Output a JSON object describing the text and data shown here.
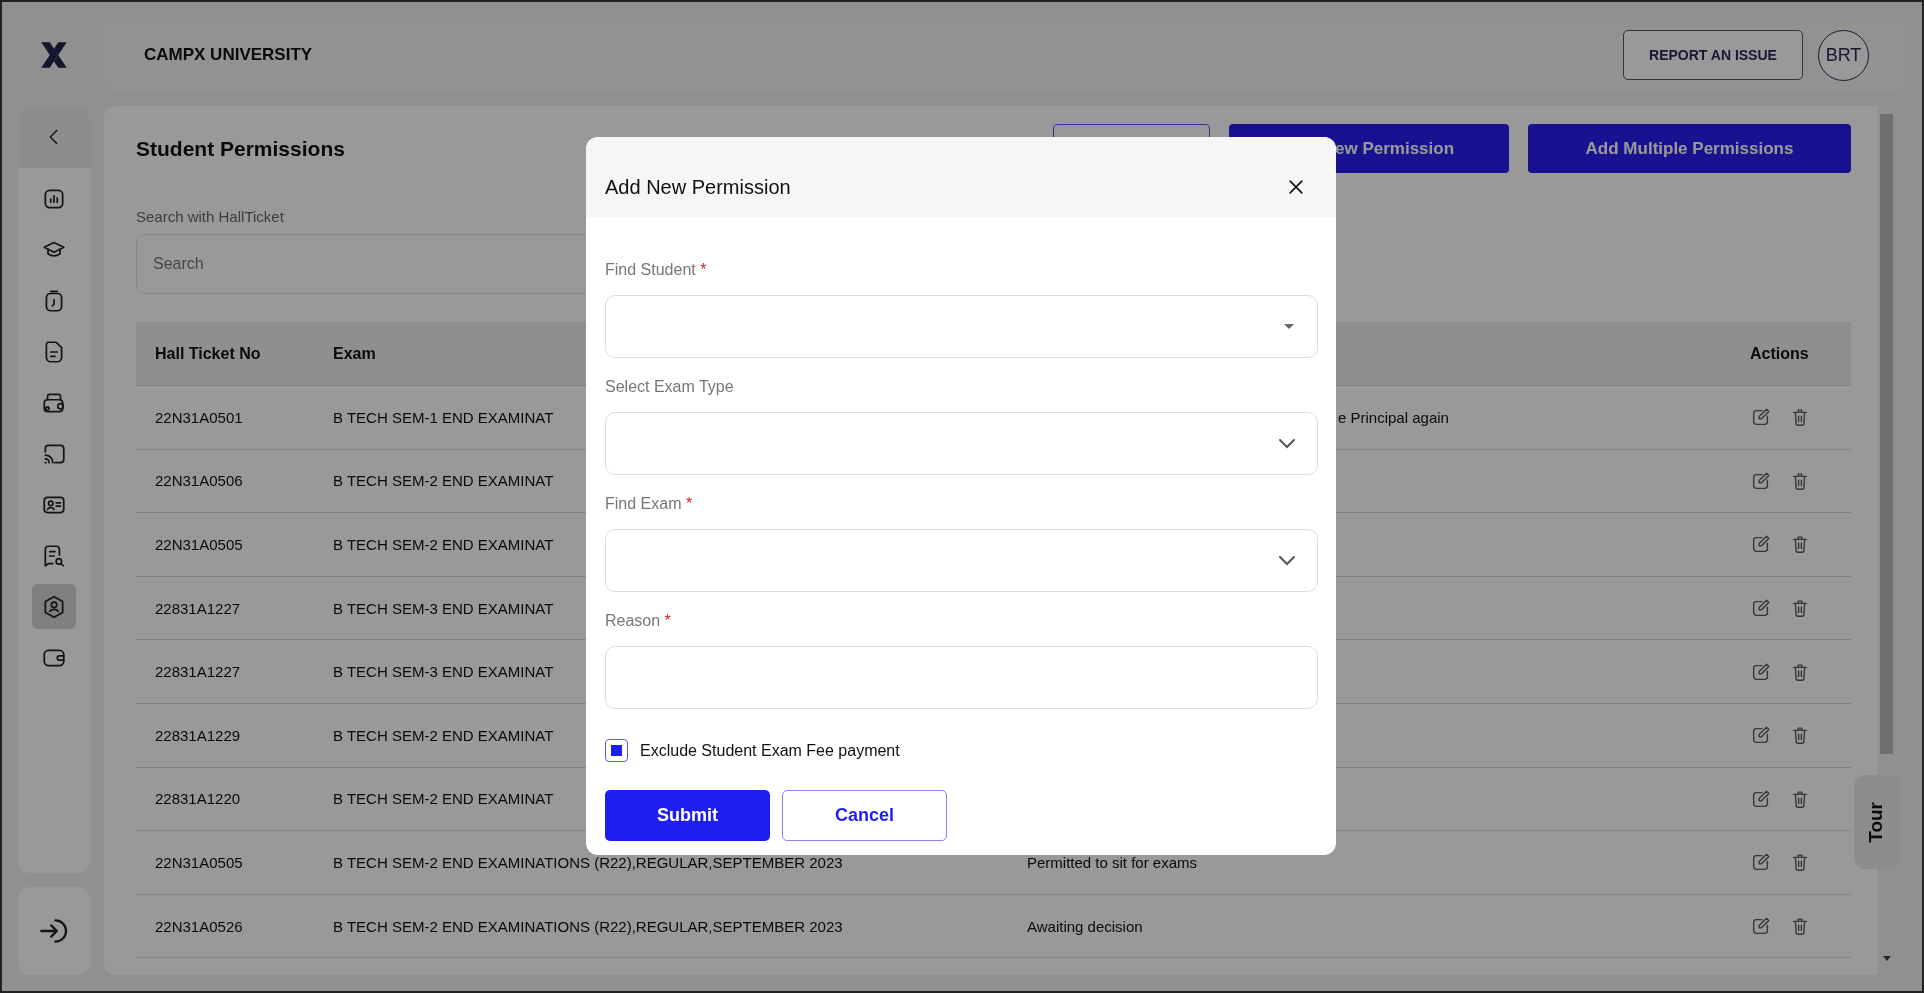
{
  "header": {
    "title": "CAMPX UNIVERSITY",
    "report_button": "REPORT AN ISSUE",
    "avatar": "BRT"
  },
  "sidebar": {
    "items": [
      {
        "selected": false
      },
      {
        "selected": false
      },
      {
        "selected": false
      },
      {
        "selected": false
      },
      {
        "selected": false
      },
      {
        "selected": false
      },
      {
        "selected": false
      },
      {
        "selected": false
      },
      {
        "selected": true
      },
      {
        "selected": false
      }
    ]
  },
  "page": {
    "title": "Student Permissions",
    "buttons": [
      {
        "kind": "outline"
      },
      {
        "kind": "primary",
        "label": "ew Permission",
        "covered": true
      },
      {
        "kind": "primary",
        "label": "Add Multiple Permissions",
        "covered": false
      }
    ],
    "search": {
      "label": "Search with HallTicket",
      "placeholder": "Search"
    }
  },
  "table": {
    "columns": {
      "hall_ticket": "Hall Ticket No",
      "exam": "Exam",
      "actions": "Actions"
    },
    "rows": [
      {
        "hall_ticket": "22N31A0501",
        "exam": "B TECH SEM-1 END EXAMINAT",
        "reason": "e Principal again",
        "covered": true
      },
      {
        "hall_ticket": "22N31A0506",
        "exam": "B TECH SEM-2 END EXAMINAT"
      },
      {
        "hall_ticket": "22N31A0505",
        "exam": "B TECH SEM-2 END EXAMINAT"
      },
      {
        "hall_ticket": "22831A1227",
        "exam": "B TECH SEM-3 END EXAMINAT"
      },
      {
        "hall_ticket": "22831A1227",
        "exam": "B TECH SEM-3 END EXAMINAT"
      },
      {
        "hall_ticket": "22831A1229",
        "exam": "B TECH SEM-2 END EXAMINAT"
      },
      {
        "hall_ticket": "22831A1220",
        "exam": "B TECH SEM-2 END EXAMINAT"
      },
      {
        "hall_ticket": "22N31A0505",
        "exam": "B TECH SEM-2 END EXAMINATIONS (R22),REGULAR,SEPTEMBER 2023",
        "reason": "Permitted to sit for exams"
      },
      {
        "hall_ticket": "22N31A0526",
        "exam": "B TECH SEM-2 END EXAMINATIONS (R22),REGULAR,SEPTEMBER 2023",
        "reason": "Awaiting decision"
      }
    ]
  },
  "dialog": {
    "title": "Add New Permission",
    "fields": [
      {
        "kind": "autocomplete",
        "label": "Find Student",
        "required_mark": "*"
      },
      {
        "kind": "select",
        "label": "Select Exam Type"
      },
      {
        "kind": "select",
        "label": "Find Exam",
        "required_mark": "*"
      },
      {
        "kind": "text",
        "label": "Reason",
        "required_mark": "*"
      }
    ],
    "checkbox": {
      "label": "Exclude Student Exam Fee payment",
      "checked": true
    },
    "buttons": [
      {
        "kind": "primary",
        "label": "Submit"
      },
      {
        "kind": "outline",
        "label": "Cancel"
      }
    ]
  },
  "tour": {
    "label": "Tour"
  }
}
